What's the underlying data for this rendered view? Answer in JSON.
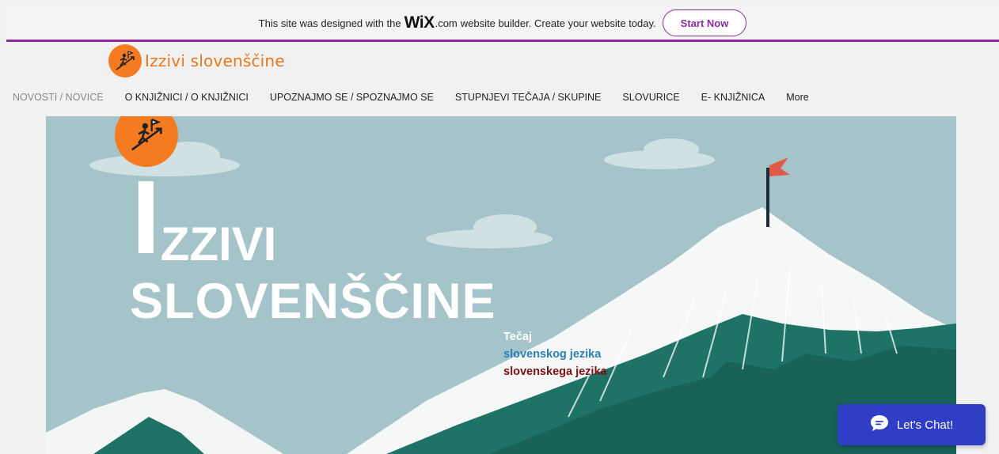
{
  "banner": {
    "text_before": "This site was designed with the",
    "brand": "WiX",
    "brand_suffix": ".com",
    "text_after": "website builder. Create your website today.",
    "start_label": "Start Now",
    "accent": "#8b2aa0"
  },
  "header": {
    "logo_text": "Izzivi slovenščine",
    "logo_color": "#f47b20"
  },
  "nav": {
    "items": [
      {
        "label": "NOVOSTI / NOVICE",
        "active": true
      },
      {
        "label": "O KNJIŽNICI / O KNJIŽNICI"
      },
      {
        "label": "UPOZNAJMO SE / SPOZNAJMO SE"
      },
      {
        "label": "STUPNJEVI TEČAJA / SKUPINE"
      },
      {
        "label": "SLOVURICE"
      },
      {
        "label": "E- KNJIŽNICA"
      },
      {
        "label": "More"
      }
    ]
  },
  "hero": {
    "title_initial": "I",
    "title_rest": "ZZIVI",
    "title_line2": "SLOVENŠČINE",
    "course_line1": "Tečaj",
    "course_line2": "slovenskog jezika",
    "course_line3": "slovenskega jezika",
    "icon": "climber-flag-icon"
  },
  "chat": {
    "label": "Let's Chat!",
    "icon": "chat-bubble-icon",
    "color": "#2f3ec4"
  }
}
